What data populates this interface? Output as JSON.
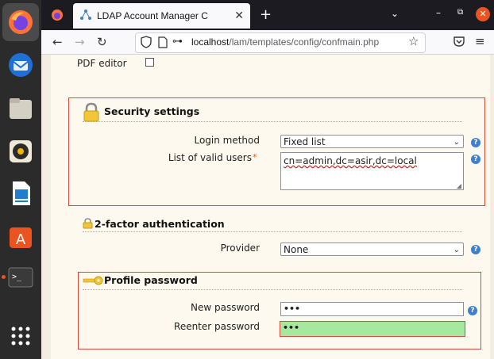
{
  "browser": {
    "tab_title": "LDAP Account Manager C",
    "url_host": "localhost",
    "url_path": "/lam/templates/config/confmain.php"
  },
  "pdf": {
    "label": "PDF editor"
  },
  "security": {
    "title": "Security settings",
    "login_method_label": "Login method",
    "login_method_value": "Fixed list",
    "valid_users_label": "List of valid users",
    "required_marker": "*",
    "valid_users_value": "cn=admin,dc=asir,dc=local"
  },
  "twofactor": {
    "title": "2-factor authentication",
    "provider_label": "Provider",
    "provider_value": "None"
  },
  "profile": {
    "title": "Profile password",
    "new_password_label": "New password",
    "new_password_value": "•••",
    "reenter_label": "Reenter password",
    "reenter_value": "•••"
  },
  "colors": {
    "accent": "#e95420",
    "section_border": "#d84a3a",
    "valid_field": "#a7e8a1"
  }
}
